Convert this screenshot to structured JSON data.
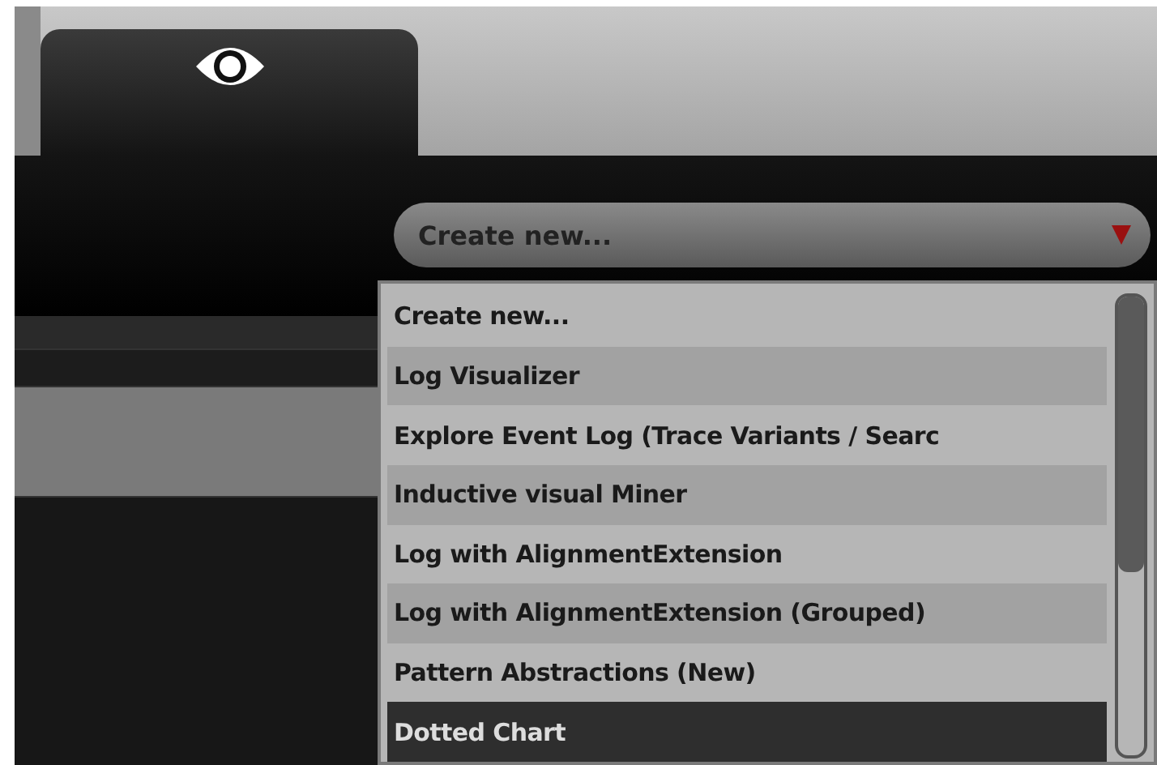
{
  "tab": {
    "selected": true
  },
  "dropdown": {
    "value": "Create new..."
  },
  "menu": {
    "items": [
      {
        "label": "Create new...",
        "selected": false
      },
      {
        "label": "Log Visualizer",
        "selected": false
      },
      {
        "label": "Explore Event Log (Trace Variants / Searc",
        "selected": false
      },
      {
        "label": "Inductive visual Miner",
        "selected": false
      },
      {
        "label": "Log with AlignmentExtension",
        "selected": false
      },
      {
        "label": "Log with AlignmentExtension (Grouped)",
        "selected": false
      },
      {
        "label": "Pattern Abstractions (New)",
        "selected": false
      },
      {
        "label": "Dotted Chart",
        "selected": true
      }
    ]
  }
}
